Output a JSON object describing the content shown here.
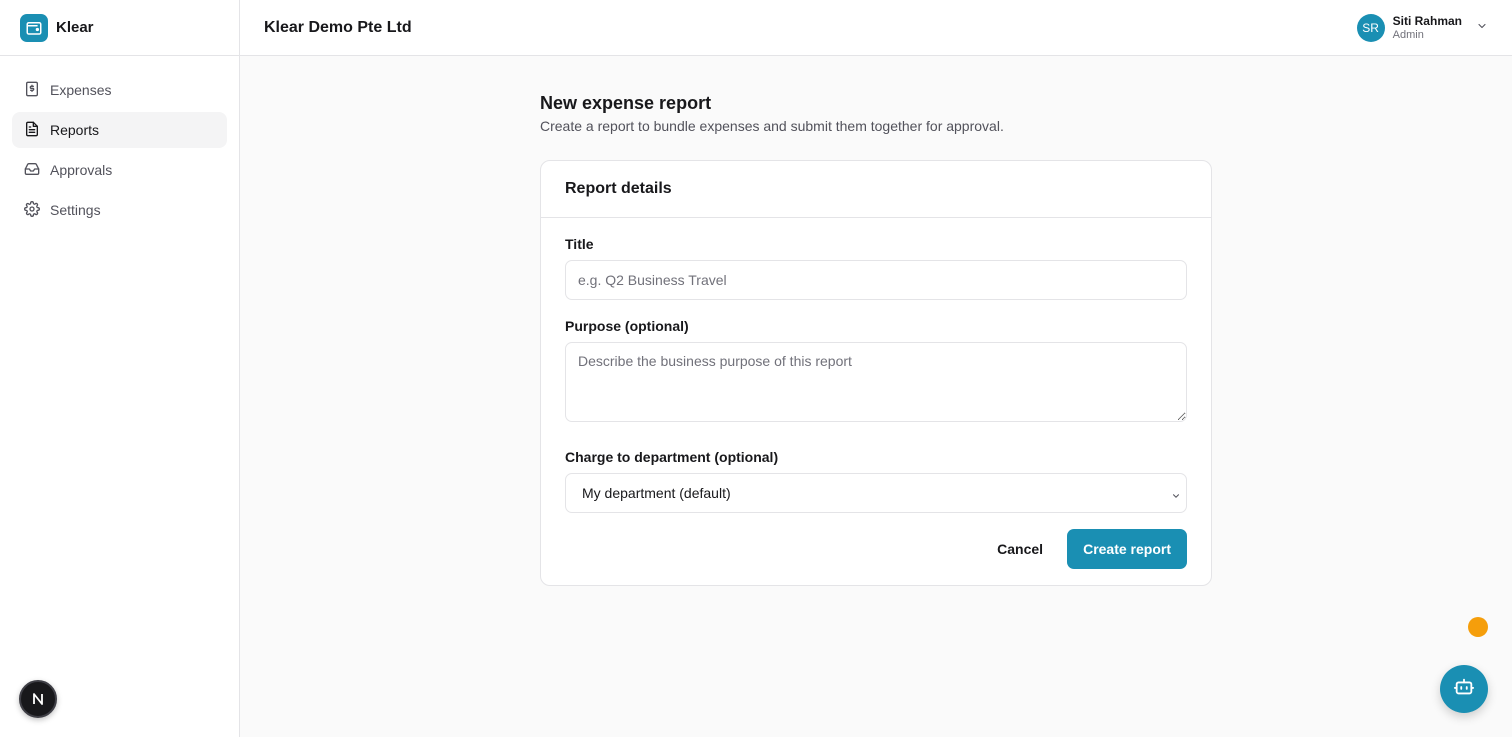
{
  "brand": {
    "name": "Klear",
    "color": "#1a8fb3"
  },
  "sidebar": {
    "items": [
      {
        "label": "Expenses",
        "icon": "receipt-icon",
        "active": false
      },
      {
        "label": "Reports",
        "icon": "file-text-icon",
        "active": true
      },
      {
        "label": "Approvals",
        "icon": "inbox-icon",
        "active": false
      },
      {
        "label": "Settings",
        "icon": "gear-icon",
        "active": false
      }
    ],
    "bottom_badge": "N"
  },
  "header": {
    "company": "Klear Demo Pte Ltd",
    "user": {
      "initials": "SR",
      "name": "Siti Rahman",
      "role": "Admin"
    }
  },
  "page": {
    "title": "New expense report",
    "subtitle": "Create a report to bundle expenses and submit them together for approval."
  },
  "form": {
    "card_title": "Report details",
    "title_label": "Title",
    "title_placeholder": "e.g. Q2 Business Travel",
    "title_value": "",
    "purpose_label": "Purpose (optional)",
    "purpose_placeholder": "Describe the business purpose of this report",
    "purpose_value": "",
    "department_label": "Charge to department (optional)",
    "department_selected": "My department (default)",
    "cancel_label": "Cancel",
    "submit_label": "Create report"
  },
  "colors": {
    "accent": "#1a8fb3",
    "notification_dot": "#f59e0b"
  },
  "assistant_button_icon": "bot-icon"
}
